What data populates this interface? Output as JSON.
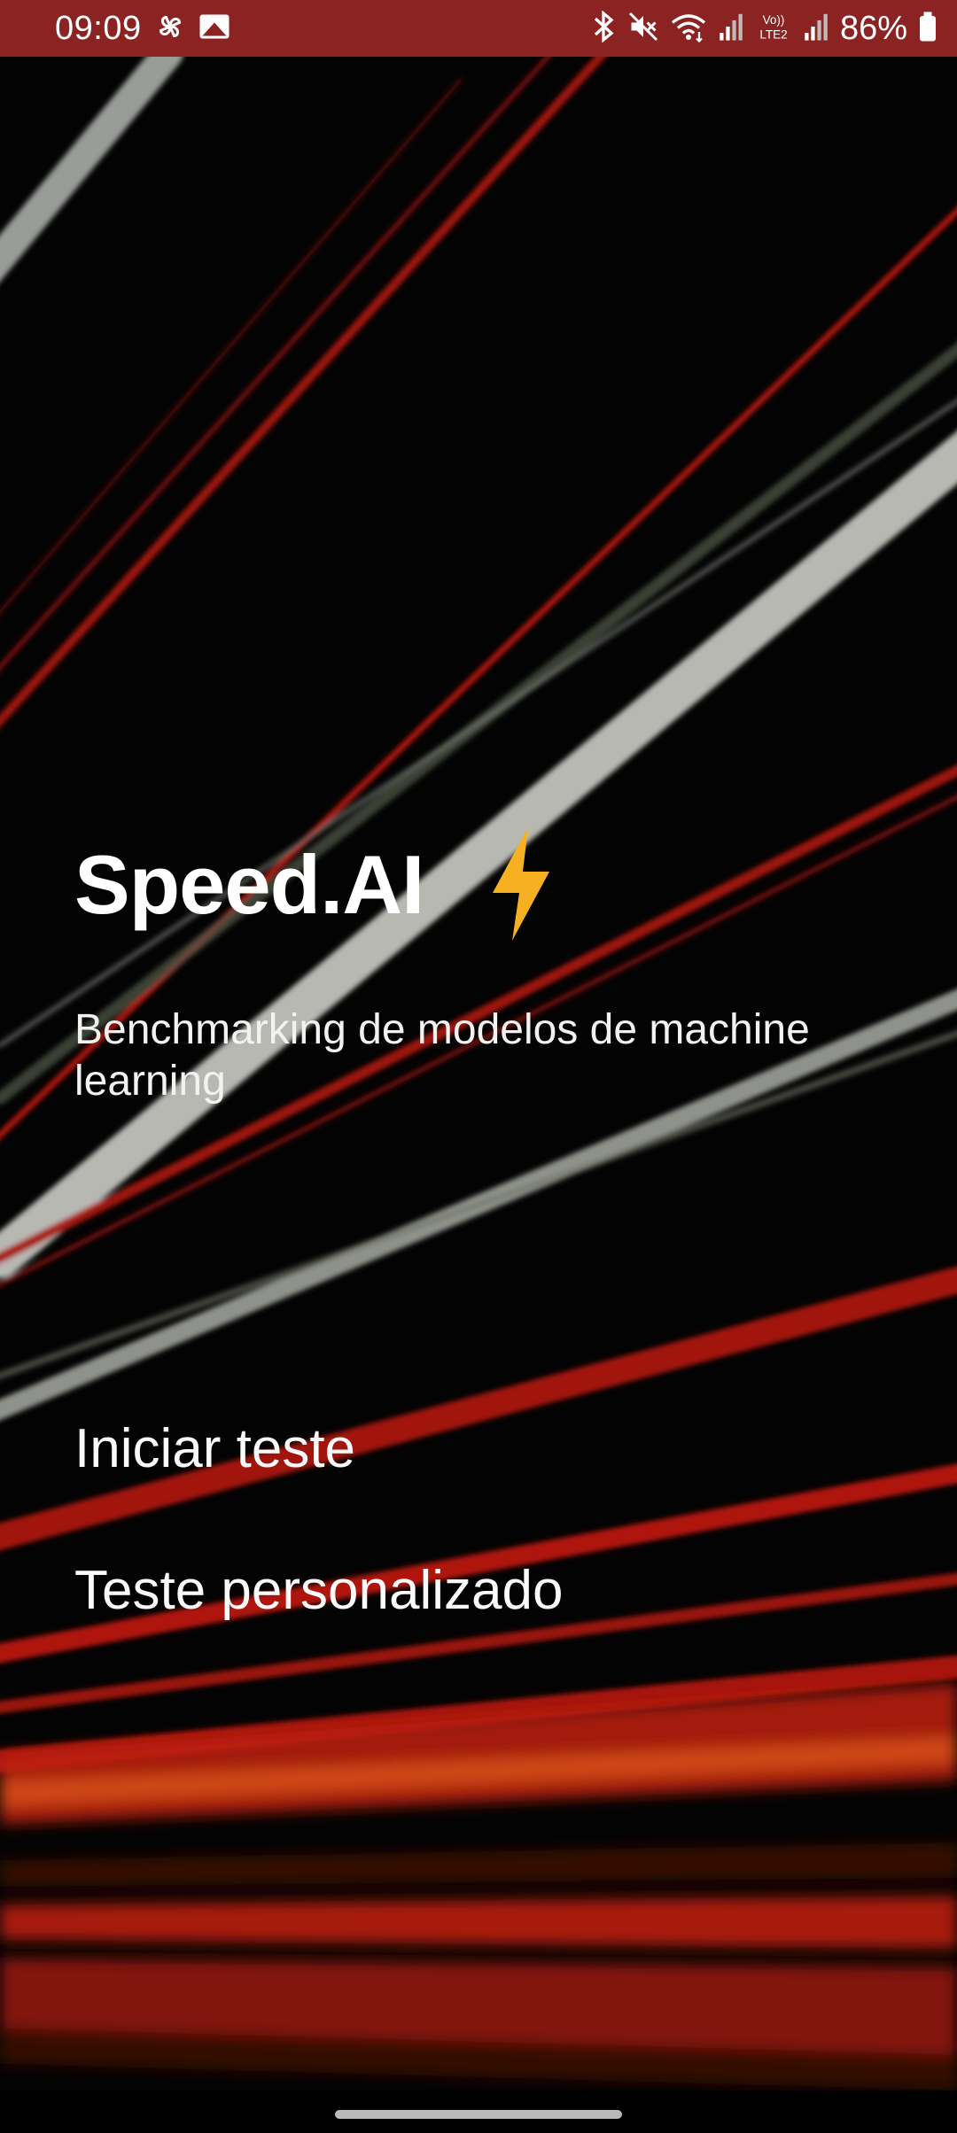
{
  "status_bar": {
    "time": "09:09",
    "battery": "86%",
    "icons": [
      "pinwheel-icon",
      "gallery-icon",
      "bluetooth-icon",
      "mute-icon",
      "wifi-icon",
      "signal-icon",
      "volte-lte2-icon",
      "signal-icon",
      "battery-icon"
    ],
    "background_color": "#8c2323",
    "network_label": "LTE2",
    "volte_label": "Vo))"
  },
  "hero": {
    "title": "Speed.AI",
    "title_icon": "lightning-bolt-icon",
    "bolt_color": "#f7b021",
    "subtitle": "Benchmarking de modelos de machine learning"
  },
  "menu": {
    "start_test_label": "Iniciar teste",
    "custom_test_label": "Teste personalizado"
  },
  "background": {
    "description_colors": [
      "#000000",
      "#c41b12",
      "#e8e8e0",
      "#ff6a10"
    ]
  }
}
